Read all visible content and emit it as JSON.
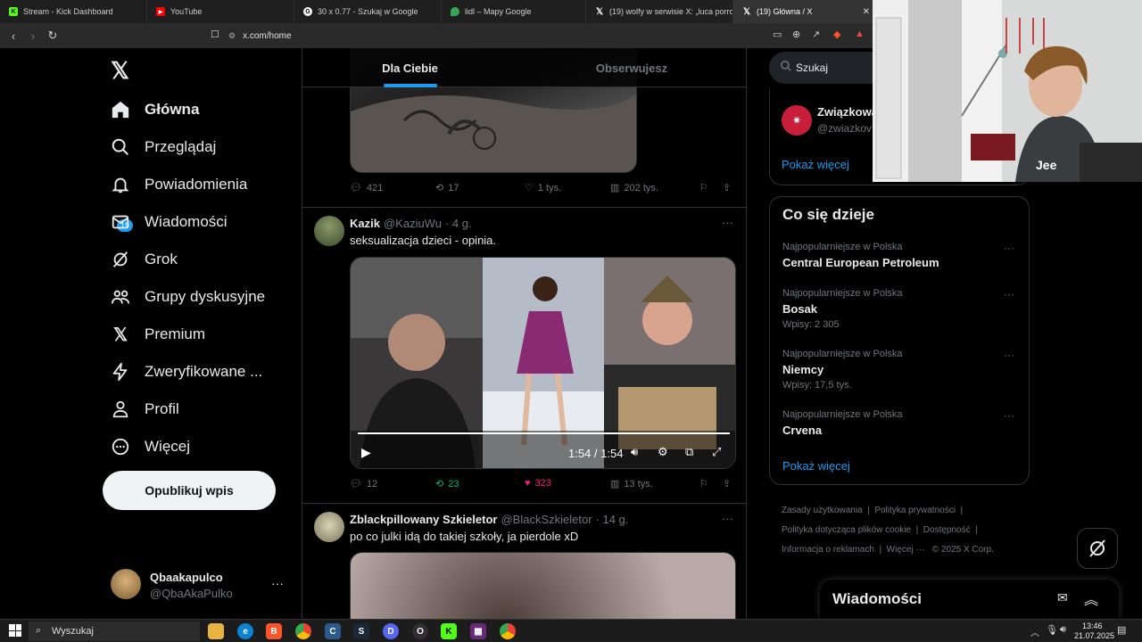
{
  "browser": {
    "tabs": [
      {
        "title": "Stream - Kick Dashboard",
        "icon": "kick-icon",
        "color": "#53fc18"
      },
      {
        "title": "YouTube",
        "icon": "youtube-icon",
        "color": "#ff0000"
      },
      {
        "title": "30 x 0.77 - Szukaj w Google",
        "icon": "google-icon",
        "color": "#ffffff"
      },
      {
        "title": "lidl – Mapy Google",
        "icon": "maps-icon",
        "color": "#34a853"
      },
      {
        "title": "(19) wolfy w serwisie X: „luca porro b...",
        "icon": "x-icon",
        "color": "#ffffff"
      },
      {
        "title": "(19) Główna / X",
        "icon": "x-icon",
        "color": "#ffffff"
      }
    ],
    "url": "x.com/home"
  },
  "nav": {
    "items": [
      {
        "label": "Główna",
        "icon": "home-icon"
      },
      {
        "label": "Przeglądaj",
        "icon": "search-icon"
      },
      {
        "label": "Powiadomienia",
        "icon": "bell-icon"
      },
      {
        "label": "Wiadomości",
        "icon": "envelope-icon"
      },
      {
        "label": "Grok",
        "icon": "grok-icon"
      },
      {
        "label": "Grupy dyskusyjne",
        "icon": "people-icon"
      },
      {
        "label": "Premium",
        "icon": "x-premium-icon"
      },
      {
        "label": "Zweryfikowane ...",
        "icon": "lightning-icon"
      },
      {
        "label": "Profil",
        "icon": "person-icon"
      },
      {
        "label": "Więcej",
        "icon": "more-circle-icon"
      }
    ],
    "notif_badge": "19",
    "post_button": "Opublikuj wpis",
    "account": {
      "name": "Qbaakapulco",
      "handle": "@QbaAkaPulko"
    }
  },
  "feed": {
    "tabs": [
      "Dla Ciebie",
      "Obserwujesz"
    ],
    "tweets": [
      {
        "stats": {
          "replies": "421",
          "reposts": "17",
          "likes": "1 tys.",
          "views": "202 tys."
        }
      },
      {
        "name": "Kazik",
        "handle": "@KaziuWu",
        "time": "· 4 g.",
        "text": "seksualizacja dzieci - opinia.",
        "video_time": "1:54 / 1:54",
        "stats": {
          "replies": "12",
          "reposts": "23",
          "likes": "323",
          "views": "13 tys."
        }
      },
      {
        "name": "Zblackpillowany Szkieletor",
        "handle": "@BlackSzkieletor",
        "time": "· 14 g.",
        "text": "po co julki idą do takiej szkoły, ja pierdole xD"
      }
    ]
  },
  "sidebar": {
    "search_placeholder": "Szukaj",
    "follow": {
      "name": "Związkowa",
      "handle": "@zwiazkov",
      "show_more": "Pokaż więcej"
    },
    "trends_title": "Co się dzieje",
    "trends": [
      {
        "context": "Najpopularniejsze w Polska",
        "name": "Central European Petroleum",
        "count": ""
      },
      {
        "context": "Najpopularniejsze w Polska",
        "name": "Bosak",
        "count": "Wpisy: 2 305"
      },
      {
        "context": "Najpopularniejsze w Polska",
        "name": "Niemcy",
        "count": "Wpisy: 17,5 tys."
      },
      {
        "context": "Najpopularniejsze w Polska",
        "name": "Crvena",
        "count": ""
      }
    ],
    "trends_more": "Pokaż więcej",
    "footer": [
      "Zasady użytkowania",
      "Polityka prywatności",
      "Polityka dotycząca plików cookie",
      "Dostępność",
      "Informacja o reklamach",
      "Więcej ···",
      "© 2025 X Corp."
    ],
    "messages_title": "Wiadomości"
  },
  "taskbar": {
    "search": "Wyszukaj",
    "time": "13:46",
    "date": "21.07.2025"
  }
}
